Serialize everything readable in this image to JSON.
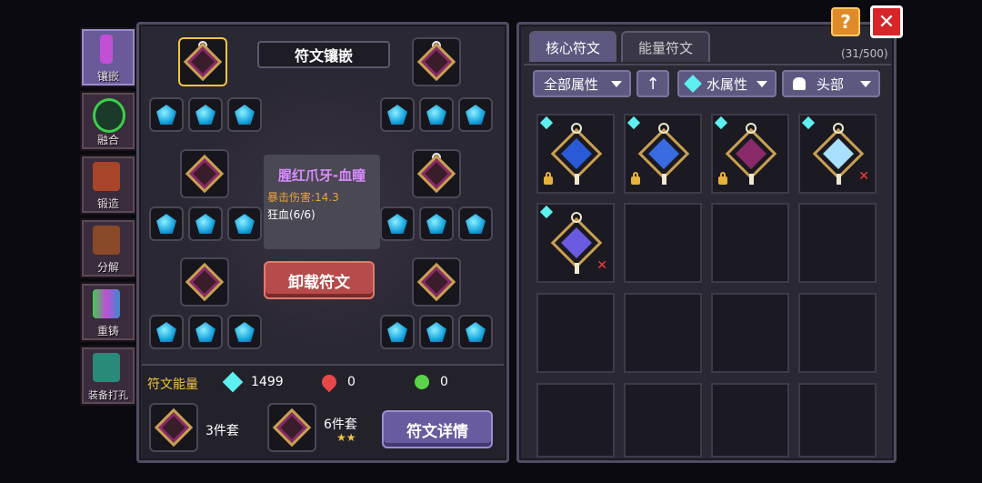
{
  "tabs": [
    {
      "label": "镶嵌"
    },
    {
      "label": "融合"
    },
    {
      "label": "锻造"
    },
    {
      "label": "分解"
    },
    {
      "label": "重铸"
    },
    {
      "label": "装备打孔"
    }
  ],
  "left": {
    "title": "符文镶嵌",
    "rune_name": "腥红爪牙-血瞳",
    "stat": "暴击伤害:14.3",
    "set_bonus": "狂血(6/6)",
    "unload_label": "卸载符文",
    "energy_label": "符文能量",
    "energy_water": "1499",
    "energy_fire": "0",
    "energy_nature": "0",
    "set3_label": "3件套",
    "set6_label": "6件套",
    "detail_label": "符文详情"
  },
  "right": {
    "tab_core": "核心符文",
    "tab_energy": "能量符文",
    "count": "(31/500)",
    "filter_all": "全部属性",
    "filter_water": "水属性",
    "filter_head": "头部"
  },
  "colors": {
    "accent_gold": "#f2c53d",
    "water": "#5ef0f0",
    "fire": "#e8484a",
    "nature": "#5ad24a",
    "rune_name": "#d98bff",
    "stat": "#e8a33a"
  }
}
